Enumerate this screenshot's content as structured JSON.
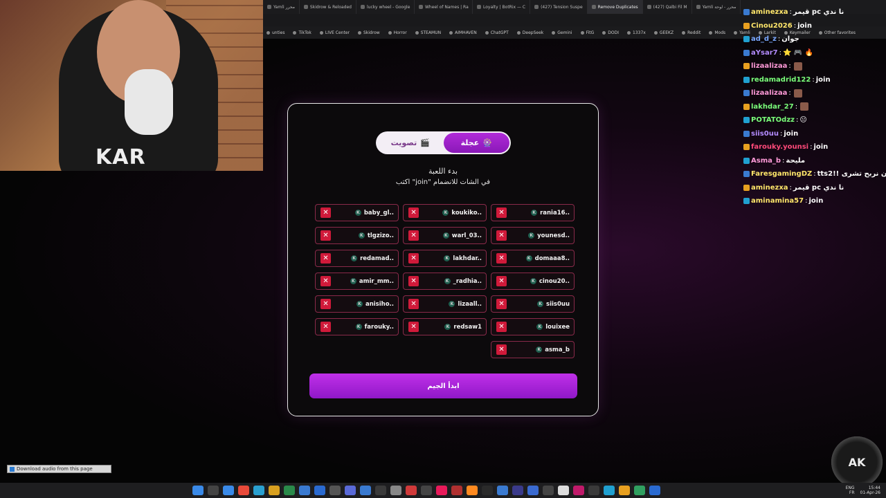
{
  "browser": {
    "tabs": [
      {
        "label": "Yamli محرر"
      },
      {
        "label": "Skidrow & Reloaded"
      },
      {
        "label": "lucky wheel - Google"
      },
      {
        "label": "Wheel of Names | Ra"
      },
      {
        "label": "Loyalty | BotRix — C"
      },
      {
        "label": "(427) Tension Suspe"
      },
      {
        "label": "Remove Duplicates"
      },
      {
        "label": "(427) Qalbi Fil M"
      },
      {
        "label": "Yamli محرر - لوحة"
      }
    ],
    "bookmarks": [
      "unties",
      "TikTok",
      "LIVE Center",
      "Skidrow",
      "Horror",
      "STEAMUN",
      "AIMHAVEN",
      "ChatGPT",
      "DeepSeek",
      "Gemini",
      "FitG",
      "DODI",
      "1337x",
      "GEEKZ",
      "Reddit",
      "Mods",
      "Yamli",
      "Larkit",
      "Keymailer",
      "Other favorites"
    ]
  },
  "webcam": {
    "shirt_text": "KAR"
  },
  "chat": [
    {
      "name": "aminezxa",
      "color": "#ffe66a",
      "msg": "قيمر pc نا ندي"
    },
    {
      "name": "Cinou2026",
      "color": "#ffe66a",
      "msg": "join"
    },
    {
      "name": "ad_d_z",
      "color": "#7aa8ff",
      "msg": "جوان"
    },
    {
      "name": "aYsar7",
      "color": "#b48cff",
      "msg": "⭐ 🎮 🔥"
    },
    {
      "name": "lizaalizaa",
      "color": "#ff9ad8",
      "msg": ""
    },
    {
      "name": "redamadrid122",
      "color": "#7aff7a",
      "msg": "join"
    },
    {
      "name": "lizaalizaa",
      "color": "#ff9ad8",
      "msg": ""
    },
    {
      "name": "lakhdar_27",
      "color": "#7aff7a",
      "msg": ""
    },
    {
      "name": "POTATOdzz",
      "color": "#7aff7a",
      "msg": "😐"
    },
    {
      "name": "siis0uu",
      "color": "#b48cff",
      "msg": "join"
    },
    {
      "name": "farouky.younsi",
      "color": "#ff4a7a",
      "msg": "join"
    },
    {
      "name": "Asma_b",
      "color": "#ff9ad8",
      "msg": "مليحة"
    },
    {
      "name": "FaresgamingDZ",
      "color": "#ffe66a",
      "msg": "tts2!! ون نربح تشرى"
    },
    {
      "name": "aminezxa",
      "color": "#ffe66a",
      "msg": "قيمر pc نا ندي"
    },
    {
      "name": "aminamina57",
      "color": "#ffe66a",
      "msg": "join"
    }
  ],
  "modal": {
    "toggle": {
      "wheel_label": "عجلة",
      "wheel_icon": "🎡",
      "vote_label": "تصويت",
      "vote_icon": "🎬"
    },
    "title": "بدء اللعبة",
    "instructions": "اكتب \"join\" في الشات للانضمام",
    "players": [
      "rania16..",
      "koukiko..",
      "baby_gl..",
      "younesd..",
      "warl_03..",
      "tlgzizo..",
      "domaaa8..",
      "lakhdar..",
      "redamad..",
      "cinou20..",
      "_radhia..",
      "amir_mm..",
      "siis0uu",
      "lizaall..",
      "anisiho..",
      "louixee",
      "redsaw1",
      "farouky..",
      "asma_b"
    ],
    "player_badge": "K",
    "remove_symbol": "✕",
    "start_label": "ابدأ الجيم"
  },
  "download": {
    "label": "Download audio from this page"
  },
  "logo": {
    "text": "AK"
  },
  "taskbar": {
    "lang_top": "ENG",
    "lang_bottom": "FR",
    "time": "15:44",
    "date": "01-Apr-26"
  },
  "colors": {
    "accent": "#a020d0",
    "remove_red": "#d01a3a",
    "player_border": "#8a2a4a"
  }
}
